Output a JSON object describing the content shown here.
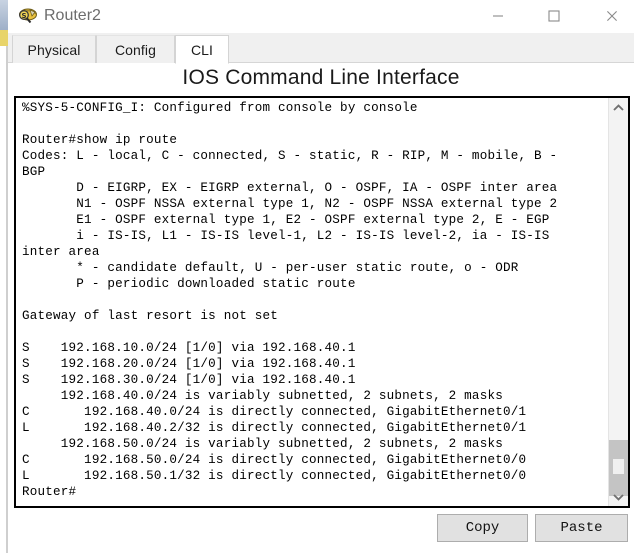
{
  "window": {
    "title": "Router2",
    "icon": "packet-tracer-router-icon",
    "controls": {
      "minimize": "minimize-icon",
      "maximize": "maximize-icon",
      "close": "close-icon"
    }
  },
  "tabs": [
    {
      "label": "Physical",
      "active": false
    },
    {
      "label": "Config",
      "active": false
    },
    {
      "label": "CLI",
      "active": true
    }
  ],
  "heading": "IOS Command Line Interface",
  "terminal": {
    "content": "%SYS-5-CONFIG_I: Configured from console by console\n\nRouter#show ip route\nCodes: L - local, C - connected, S - static, R - RIP, M - mobile, B -\nBGP\n       D - EIGRP, EX - EIGRP external, O - OSPF, IA - OSPF inter area\n       N1 - OSPF NSSA external type 1, N2 - OSPF NSSA external type 2\n       E1 - OSPF external type 1, E2 - OSPF external type 2, E - EGP\n       i - IS-IS, L1 - IS-IS level-1, L2 - IS-IS level-2, ia - IS-IS\ninter area\n       * - candidate default, U - per-user static route, o - ODR\n       P - periodic downloaded static route\n\nGateway of last resort is not set\n\nS    192.168.10.0/24 [1/0] via 192.168.40.1\nS    192.168.20.0/24 [1/0] via 192.168.40.1\nS    192.168.30.0/24 [1/0] via 192.168.40.1\n     192.168.40.0/24 is variably subnetted, 2 subnets, 2 masks\nC       192.168.40.0/24 is directly connected, GigabitEthernet0/1\nL       192.168.40.2/32 is directly connected, GigabitEthernet0/1\n     192.168.50.0/24 is variably subnetted, 2 subnets, 2 masks\nC       192.168.50.0/24 is directly connected, GigabitEthernet0/0\nL       192.168.50.1/32 is directly connected, GigabitEthernet0/0\nRouter#"
  },
  "scrollbar": {
    "up_icon": "chevron-up-icon",
    "down_icon": "chevron-down-icon"
  },
  "buttons": {
    "copy": "Copy",
    "paste": "Paste"
  },
  "colors": {
    "terminal_border": "#000000",
    "tab_active_bg": "#ffffff",
    "tab_bg": "#f0f0f0",
    "button_bg": "#e1e1e1",
    "scroll_thumb": "#c4c4c4",
    "title_text": "#6d6d6d"
  }
}
